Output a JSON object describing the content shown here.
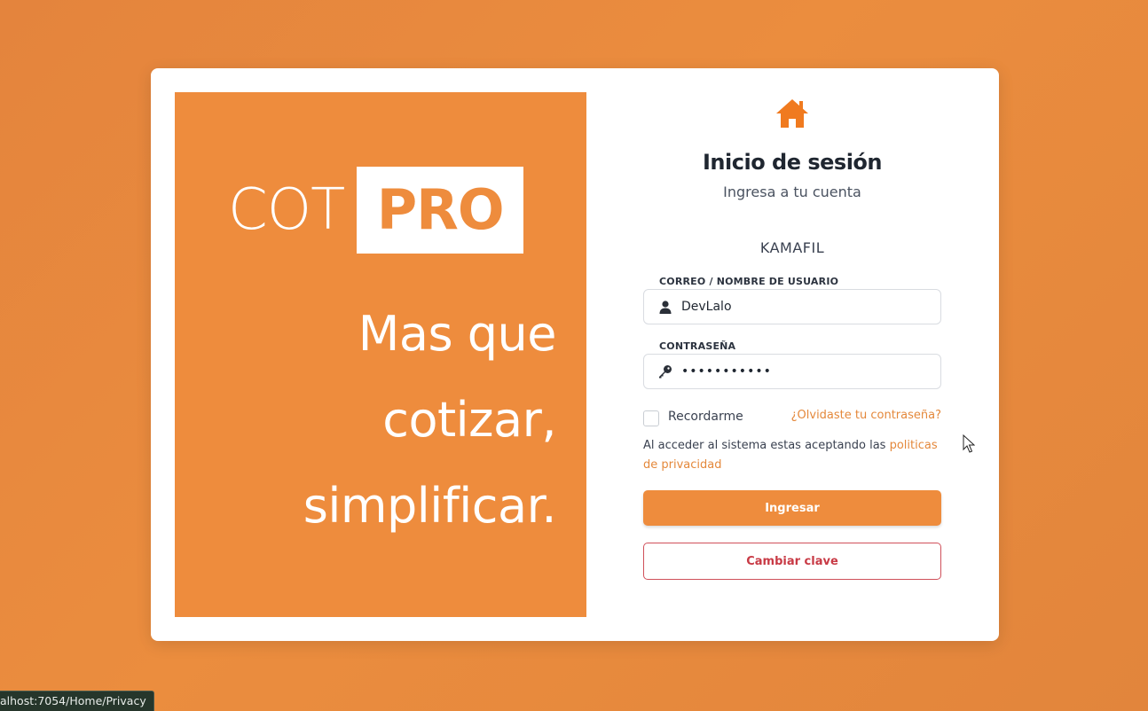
{
  "brand": {
    "logo_left": "COT",
    "logo_right": "PRO",
    "tagline": [
      "Mas que",
      "cotizar,",
      "simplificar."
    ]
  },
  "login": {
    "home_icon": "home-icon",
    "title": "Inicio de sesión",
    "subtitle": "Ingresa a tu cuenta",
    "company": "KAMAFIL",
    "user_label": "CORREO / NOMBRE DE USUARIO",
    "user_value": "DevLalo",
    "user_icon": "user-icon",
    "password_label": "CONTRASEÑA",
    "password_value": "•••••••••••",
    "password_icon": "key-icon",
    "remember_label": "Recordarme",
    "forgot_link": "¿Olvidaste tu contraseña?",
    "terms_text": "Al acceder al sistema estas aceptando las",
    "terms_link": "politicas de privacidad",
    "login_button": "Ingresar",
    "change_password_button": "Cambiar clave"
  },
  "status_bar": {
    "url": "alhost:7054/Home/Privacy"
  },
  "colors": {
    "accent": "#ee8c3d",
    "danger": "#c83a45",
    "background": "#e98a3d"
  }
}
